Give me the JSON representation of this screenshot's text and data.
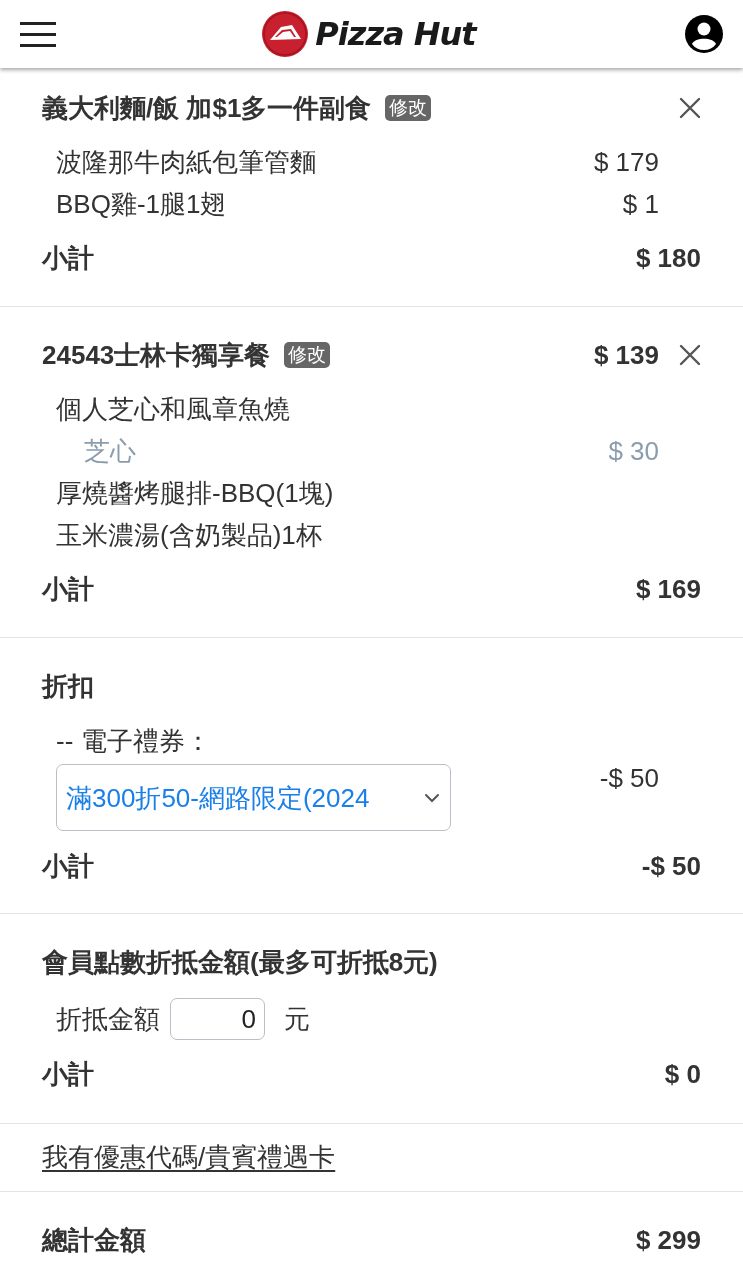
{
  "header": {
    "logo_text": "Pizza Hut"
  },
  "sections": [
    {
      "kind": "product",
      "title": "義大利麵/飯 加$1多一件副食",
      "edit_label": "修改",
      "items": [
        {
          "name": "波隆那牛肉紙包筆管麵",
          "price": "$ 179"
        },
        {
          "name": "BBQ雞-1腿1翅",
          "price": "$ 1"
        }
      ],
      "subtotal_label": "小計",
      "subtotal": "$ 180"
    },
    {
      "kind": "product",
      "title": "24543士林卡獨享餐",
      "edit_label": "修改",
      "price": "$ 139",
      "items": [
        {
          "name": "個人芝心和風章魚燒",
          "children": [
            {
              "name": "芝心",
              "price": "$ 30"
            }
          ]
        },
        {
          "name": "厚燒醬烤腿排-BBQ(1塊)"
        },
        {
          "name": "玉米濃湯(含奶製品)1杯"
        }
      ],
      "subtotal_label": "小計",
      "subtotal": "$ 169"
    },
    {
      "kind": "discount",
      "title": "折扣",
      "label": "-- 電子禮券：",
      "select_value": "滿300折50-網路限定(2024",
      "amount": "-$ 50",
      "subtotal_label": "小計",
      "subtotal": "-$ 50"
    },
    {
      "kind": "points",
      "title": "會員點數折抵金額(最多可折抵8元)",
      "field_label": "折抵金額",
      "field_value": "0",
      "unit": "元",
      "subtotal_label": "小計",
      "subtotal": "$ 0"
    },
    {
      "kind": "link",
      "text": "我有優惠代碼/貴賓禮遇卡"
    },
    {
      "kind": "total",
      "label": "總計金額",
      "amount": "$ 299"
    }
  ]
}
